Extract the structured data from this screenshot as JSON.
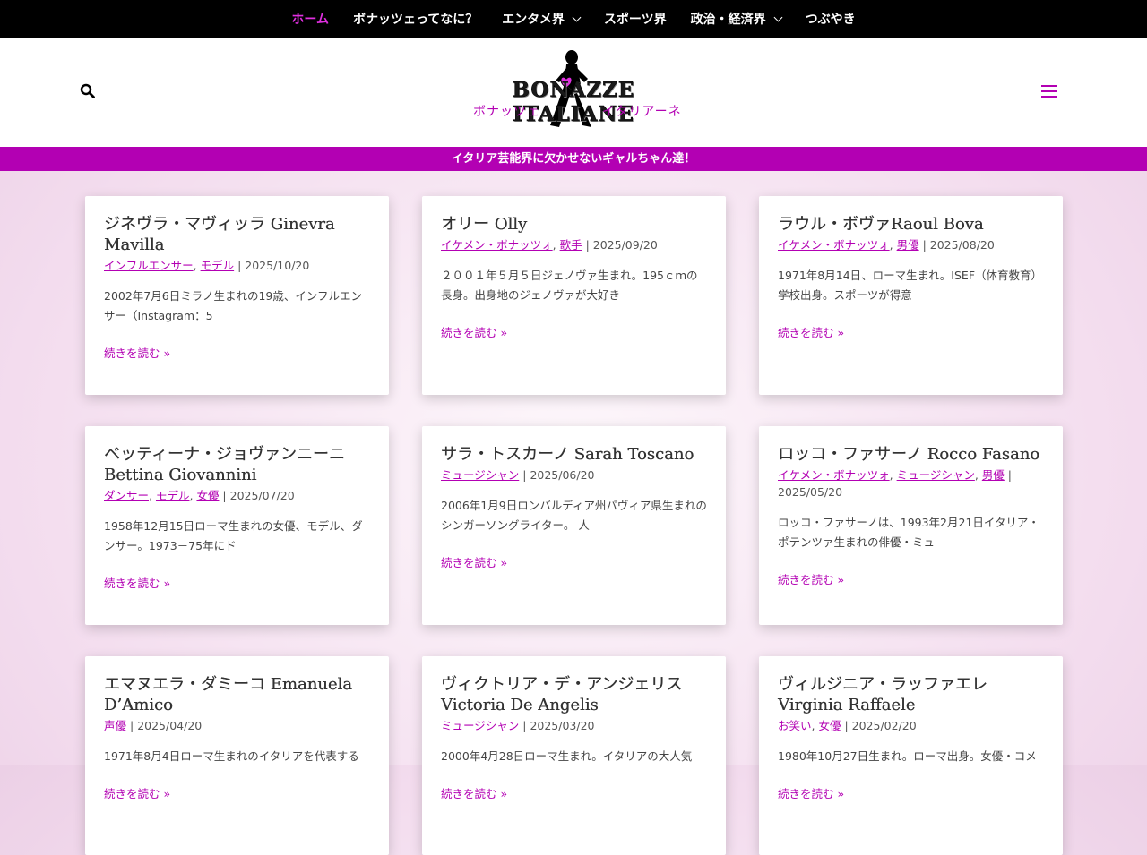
{
  "nav": {
    "items": [
      {
        "label": "ホーム",
        "active": true,
        "dropdown": false
      },
      {
        "label": "ボナッツェってなに？",
        "active": false,
        "dropdown": false
      },
      {
        "label": "エンタメ界",
        "active": false,
        "dropdown": true
      },
      {
        "label": "スポーツ界",
        "active": false,
        "dropdown": false
      },
      {
        "label": "政治・経済界",
        "active": false,
        "dropdown": true
      },
      {
        "label": "つぶやき",
        "active": false,
        "dropdown": false
      }
    ]
  },
  "header": {
    "logo_text": "BONAZZE ITALIANE",
    "logo_sub_left": "ボナッツェ",
    "logo_sub_right": "イタリアーネ",
    "tagline": "イタリア芸能界に欠かせないギャルちゃん達！"
  },
  "colors": {
    "accent": "#b300b3",
    "active_nav": "#e02fe0"
  },
  "posts": [
    {
      "title": "ジネヴラ・マヴィッラ Ginevra Mavilla",
      "cats": [
        "インフルエンサー",
        "モデル"
      ],
      "date": "2025/10/20",
      "excerpt": "2002年7月6日ミラノ生まれの19歳、インフルエンサー（Instagram：5",
      "readmore": "続きを読む »"
    },
    {
      "title": "オリー Olly",
      "cats": [
        "イケメン・ボナッツォ",
        "歌手"
      ],
      "date": "2025/09/20",
      "excerpt": "２００１年５月５日ジェノヴァ生まれ。195ｃｍの長身。出身地のジェノヴァが大好き",
      "readmore": "続きを読む »"
    },
    {
      "title": "ラウル・ボヴァRaoul Bova",
      "cats": [
        "イケメン・ボナッツォ",
        "男優"
      ],
      "date": "2025/08/20",
      "excerpt": "1971年8月14日、ローマ生まれ。ISEF（体育教育）学校出身。スポーツが得意",
      "readmore": "続きを読む »"
    },
    {
      "title": "ベッティーナ・ジョヴァンニーニ Bettina Giovannini",
      "cats": [
        "ダンサー",
        "モデル",
        "女優"
      ],
      "date": "2025/07/20",
      "excerpt": "1958年12月15日ローマ生まれの女優、モデル、ダンサー。1973－75年にド",
      "readmore": "続きを読む »"
    },
    {
      "title": "サラ・トスカーノ Sarah Toscano",
      "cats": [
        "ミュージシャン"
      ],
      "date": "2025/06/20",
      "excerpt": "2006年1月9日ロンバルディア州パヴィア県生まれのシンガーソングライター。 人",
      "readmore": "続きを読む »"
    },
    {
      "title": "ロッコ・ファサーノ Rocco Fasano",
      "cats": [
        "イケメン・ボナッツォ",
        "ミュージシャン",
        "男優"
      ],
      "date": "2025/05/20",
      "excerpt": "ロッコ・ファサーノは、1993年2月21日イタリア・ポテンツァ生まれの俳優・ミュ",
      "readmore": "続きを読む »"
    },
    {
      "title": "エマヌエラ・ダミーコ Emanuela D’Amico",
      "cats": [
        "声優"
      ],
      "date": "2025/04/20",
      "excerpt": "1971年8月4日ローマ生まれのイタリアを代表する",
      "readmore": "続きを読む »"
    },
    {
      "title": "ヴィクトリア・デ・アンジェリス Victoria De Angelis",
      "cats": [
        "ミュージシャン"
      ],
      "date": "2025/03/20",
      "excerpt": "2000年4月28日ローマ生まれ。イタリアの大人気",
      "readmore": "続きを読む »"
    },
    {
      "title": "ヴィルジニア・ラッファエレ Virginia Raffaele",
      "cats": [
        "お笑い",
        "女優"
      ],
      "date": "2025/02/20",
      "excerpt": "1980年10月27日生まれ。ローマ出身。女優・コメ",
      "readmore": "続きを読む »"
    }
  ]
}
